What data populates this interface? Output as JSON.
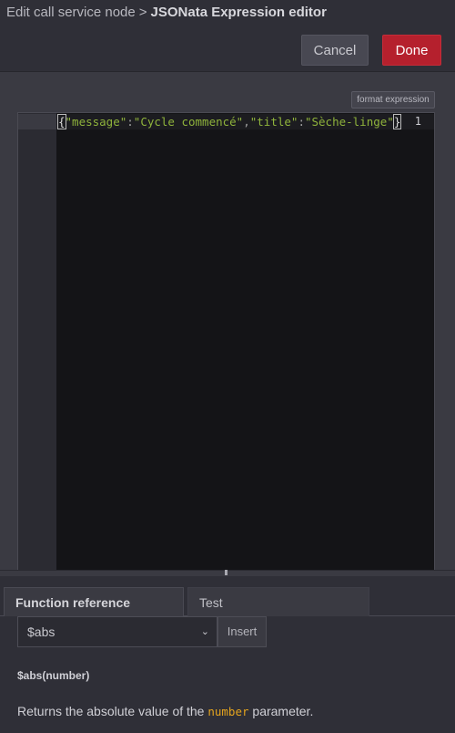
{
  "header": {
    "breadcrumb_parent": "Edit call service node",
    "separator": ">",
    "current": "JSONata Expression editor",
    "cancel_label": "Cancel",
    "done_label": "Done"
  },
  "editor": {
    "format_label": "format expression",
    "line_number": "1",
    "code": {
      "open": "{",
      "key1": "\"message\"",
      "colon1": ":",
      "val1": "\"Cycle commencé\"",
      "comma": ",",
      "key2": "\"title\"",
      "colon2": ":",
      "val2": "\"Sèche-linge\"",
      "close": "}"
    }
  },
  "reference": {
    "tabs": [
      {
        "label": "Function reference",
        "active": true
      },
      {
        "label": "Test",
        "active": false
      }
    ],
    "selected_function": "$abs",
    "insert_label": "Insert",
    "signature": "$abs(number)",
    "description_prefix": "Returns the absolute value of the",
    "description_param": "number",
    "description_suffix": "parameter."
  },
  "colors": {
    "done": "#b5202d",
    "string": "#8fb33b",
    "param": "#e4a41e"
  }
}
